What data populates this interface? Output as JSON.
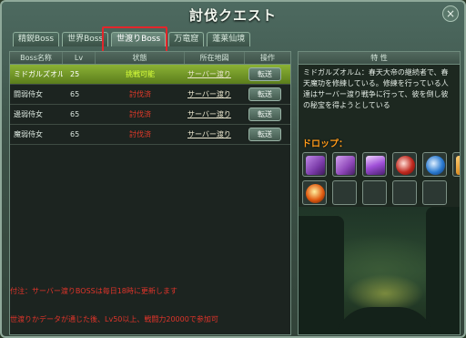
{
  "window": {
    "title": "討伐クエスト",
    "close_label": "×"
  },
  "tabs": [
    {
      "label": "精鋭Boss",
      "active": false
    },
    {
      "label": "世界Boss",
      "active": false
    },
    {
      "label": "世渡りBoss",
      "active": true
    },
    {
      "label": "万竜窟",
      "active": false
    },
    {
      "label": "蓬莱仙境",
      "active": false
    }
  ],
  "list": {
    "headers": {
      "name": "Boss名称",
      "lv": "Lv",
      "status": "状態",
      "map": "所在地図",
      "op": "操作"
    },
    "rows": [
      {
        "name": "ミドガルズオルム",
        "lv": "25",
        "status": "挑戦可能",
        "status_ok": true,
        "map": "サーバー渡り",
        "op": "転送",
        "selected": true
      },
      {
        "name": "闘弱侍女",
        "lv": "65",
        "status": "討伐済",
        "status_ok": false,
        "map": "サーバー渡り",
        "op": "転送",
        "selected": false
      },
      {
        "name": "邊弱侍女",
        "lv": "65",
        "status": "討伐済",
        "status_ok": false,
        "map": "サーバー渡り",
        "op": "転送",
        "selected": false
      },
      {
        "name": "魔弱侍女",
        "lv": "65",
        "status": "討伐済",
        "status_ok": false,
        "map": "サーバー渡り",
        "op": "転送",
        "selected": false
      }
    ]
  },
  "notes": {
    "note1": "付注：サーバー渡りBOSSは毎日18時に更新します",
    "note2": "世渡りかデータが通じた後、Lv50以上、戦闘力20000で参加可"
  },
  "detail": {
    "header": "特 性",
    "description": "ミドガルズオルム：春天大帝の継続者で、春天魔功を修練している。修練を行っている人達はサーバー渡り戦争に行って、彼を倒し彼の秘宝を得ようとしている",
    "drop_label": "ドロップ：",
    "drops": [
      {
        "icon": "scroll-purple-icon",
        "color": "#7a3aa8"
      },
      {
        "icon": "scroll-violet-icon",
        "color": "#8d46b8"
      },
      {
        "icon": "crystal-purple-icon",
        "color": "#a050d8"
      },
      {
        "icon": "yinyang-red-icon",
        "color": "#c0281e"
      },
      {
        "icon": "yinyang-blue-icon",
        "color": "#2a7ad0"
      },
      {
        "icon": "scroll-orange-icon",
        "color": "#d8861a"
      },
      {
        "icon": "flame-orb-icon",
        "color": "#e05a10"
      },
      {
        "icon": "empty-slot",
        "color": ""
      },
      {
        "icon": "empty-slot",
        "color": ""
      },
      {
        "icon": "empty-slot",
        "color": ""
      },
      {
        "icon": "empty-slot",
        "color": ""
      }
    ]
  }
}
